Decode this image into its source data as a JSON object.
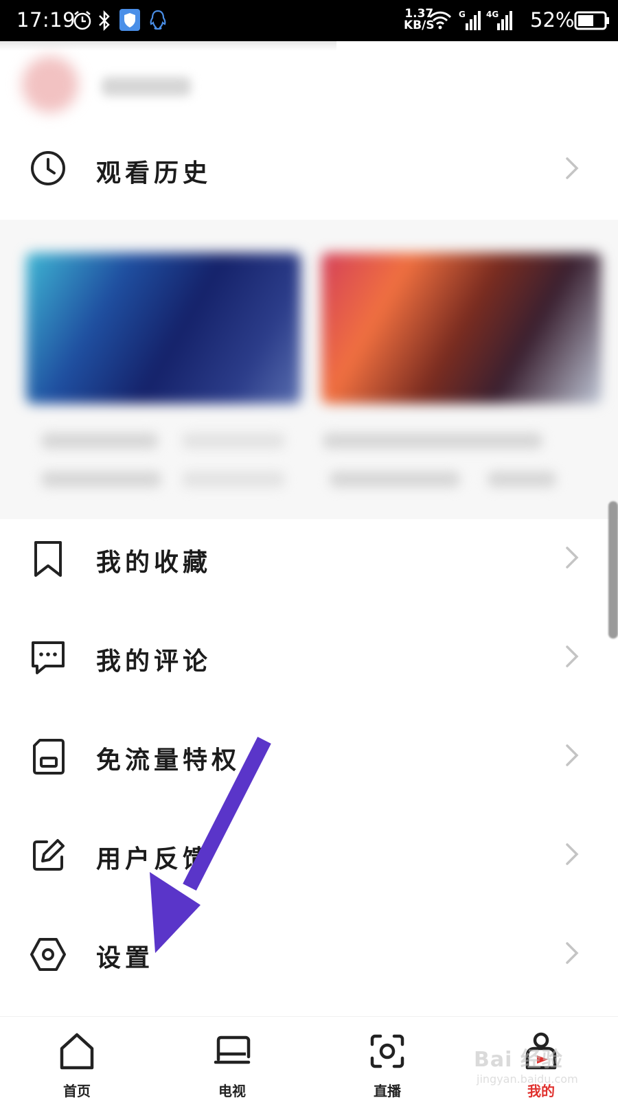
{
  "status_bar": {
    "time": "17:19",
    "net_speed_value": "1.37",
    "net_speed_unit": "KB/S",
    "signal_1_tag": "G",
    "signal_2_tag": "4G",
    "battery": "52%"
  },
  "menu": {
    "history_label": "观看历史",
    "favorites_label": "我的收藏",
    "comments_label": "我的评论",
    "free_data_label": "免流量特权",
    "feedback_label": "用户反馈",
    "settings_label": "设置"
  },
  "bottom_nav": {
    "items": [
      {
        "label": "首页",
        "icon": "home-icon"
      },
      {
        "label": "电视",
        "icon": "tv-icon"
      },
      {
        "label": "直播",
        "icon": "live-icon"
      },
      {
        "label": "我的",
        "icon": "profile-icon",
        "active": true
      }
    ]
  },
  "watermark": {
    "main": "Bai 经验",
    "sub": "jingyan.baidu.com"
  },
  "colors": {
    "accent": "#e0322f",
    "arrow": "#5a35c9",
    "text": "#1c1c1c",
    "chevron": "#c4c4c4"
  }
}
